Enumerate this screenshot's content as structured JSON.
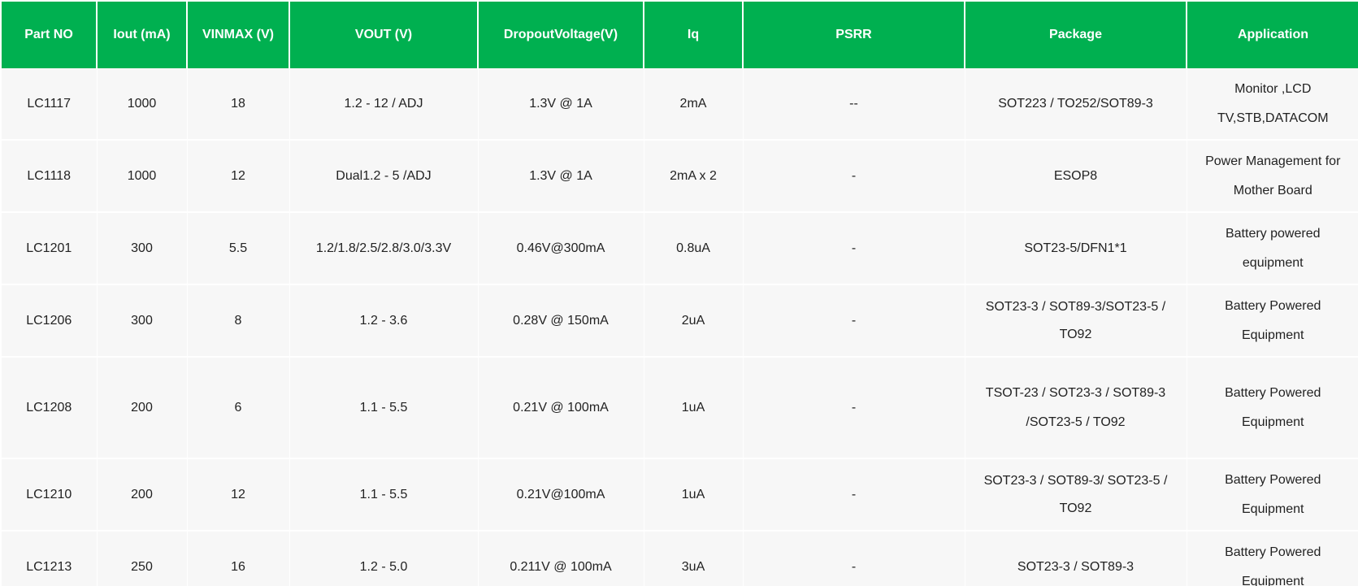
{
  "table": {
    "headers": [
      "Part NO",
      "Iout (mA)",
      "VINMAX (V)",
      "VOUT (V)",
      "DropoutVoltage(V)",
      "Iq",
      "PSRR",
      "Package",
      "Application"
    ],
    "rows": [
      {
        "part_no": "LC1117",
        "iout": "1000",
        "vinmax": "18",
        "vout": "1.2 - 12 / ADJ",
        "dropout": "1.3V @ 1A",
        "iq": "2mA",
        "psrr": "--",
        "package": "SOT223 / TO252/SOT89-3",
        "application": "Monitor ,LCD TV,STB,DATACOM"
      },
      {
        "part_no": "LC1118",
        "iout": "1000",
        "vinmax": "12",
        "vout": "Dual1.2 - 5 /ADJ",
        "dropout": "1.3V @ 1A",
        "iq": "2mA x 2",
        "psrr": "-",
        "package": "ESOP8",
        "application": "Power Management for Mother Board"
      },
      {
        "part_no": "LC1201",
        "iout": "300",
        "vinmax": "5.5",
        "vout": "1.2/1.8/2.5/2.8/3.0/3.3V",
        "dropout": "0.46V@300mA",
        "iq": "0.8uA",
        "psrr": "-",
        "package": "SOT23-5/DFN1*1",
        "application": "Battery powered equipment"
      },
      {
        "part_no": "LC1206",
        "iout": "300",
        "vinmax": "8",
        "vout": "1.2 - 3.6",
        "dropout": "0.28V @ 150mA",
        "iq": "2uA",
        "psrr": "-",
        "package": "SOT23-3 / SOT89-3/SOT23-5 / TO92",
        "application": "Battery Powered Equipment"
      },
      {
        "part_no": "LC1208",
        "iout": "200",
        "vinmax": "6",
        "vout": "1.1 - 5.5",
        "dropout": "0.21V @ 100mA",
        "iq": "1uA",
        "psrr": "-",
        "package": "TSOT-23 / SOT23-3 / SOT89-3 /SOT23-5 / TO92",
        "application": "Battery Powered Equipment"
      },
      {
        "part_no": "LC1210",
        "iout": "200",
        "vinmax": "12",
        "vout": "1.1 - 5.5",
        "dropout": "0.21V@100mA",
        "iq": "1uA",
        "psrr": "-",
        "package": "SOT23-3 / SOT89-3/ SOT23-5 / TO92",
        "application": "Battery Powered Equipment"
      },
      {
        "part_no": "LC1213",
        "iout": "250",
        "vinmax": "16",
        "vout": "1.2 - 5.0",
        "dropout": "0.211V @ 100mA",
        "iq": "3uA",
        "psrr": "-",
        "package": "SOT23-3 / SOT89-3",
        "application": "Battery Powered Equipment"
      }
    ]
  }
}
